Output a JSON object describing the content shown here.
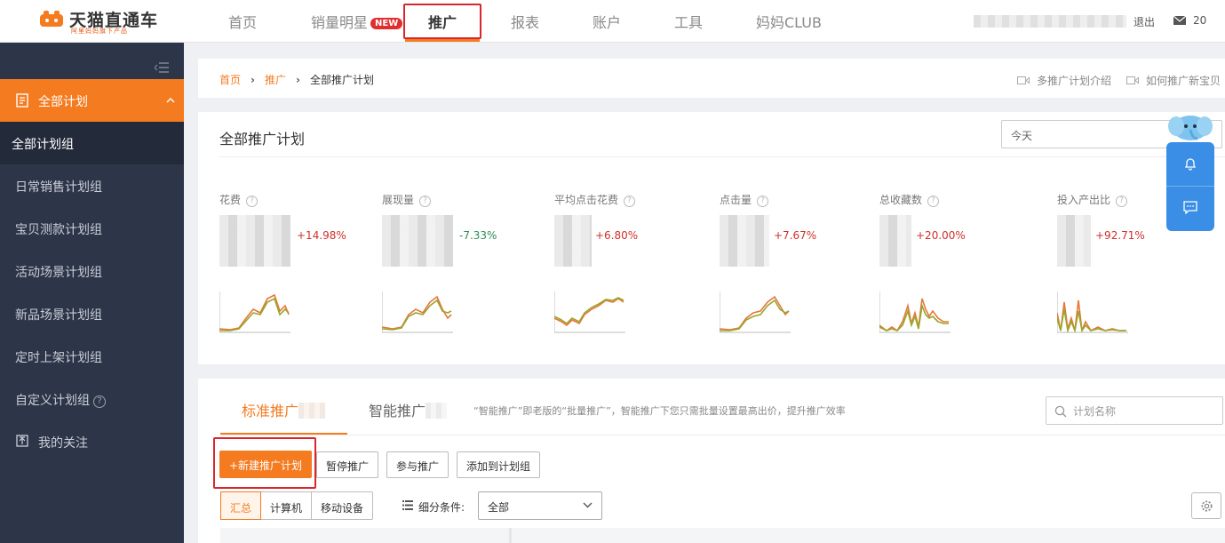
{
  "topnav": {
    "logo_title": "天猫直通车",
    "logo_sub": "阿里妈妈旗下产品",
    "items": [
      {
        "label": "首页"
      },
      {
        "label": "销量明星",
        "badge": "NEW"
      },
      {
        "label": "推广",
        "active": true
      },
      {
        "label": "报表"
      },
      {
        "label": "账户"
      },
      {
        "label": "工具"
      },
      {
        "label": "妈妈CLUB"
      }
    ],
    "logout": "退出",
    "mail_count": "20",
    "accent_color": "#f47b20"
  },
  "sidebar": {
    "header": "全部计划",
    "items": [
      {
        "label": "全部计划组",
        "active": true
      },
      {
        "label": "日常销售计划组"
      },
      {
        "label": "宝贝测款计划组"
      },
      {
        "label": "活动场景计划组"
      },
      {
        "label": "新品场景计划组"
      },
      {
        "label": "定时上架计划组"
      },
      {
        "label": "自定义计划组",
        "help": "?"
      },
      {
        "label": "我的关注"
      }
    ]
  },
  "breadcrumb": {
    "home": "首页",
    "mid": "推广",
    "current": "全部推广计划",
    "links": [
      "多推广计划介绍",
      "如何推广新宝贝"
    ]
  },
  "stats": {
    "title": "全部推广计划",
    "date_value": "今天",
    "metrics": [
      {
        "name": "花费",
        "change": "+14.98%",
        "trend": "up"
      },
      {
        "name": "展现量",
        "change": "-7.33%",
        "trend": "down"
      },
      {
        "name": "平均点击花费",
        "change": "+6.80%",
        "trend": "up"
      },
      {
        "name": "点击量",
        "change": "+7.67%",
        "trend": "up"
      },
      {
        "name": "总收藏数",
        "change": "+20.00%",
        "trend": "up"
      },
      {
        "name": "投入产出比",
        "change": "+92.71%",
        "trend": "up"
      }
    ],
    "up_color": "#d0302c",
    "down_color": "#2e8b57"
  },
  "plans": {
    "tabs": [
      {
        "label": "标准推广",
        "active": true
      },
      {
        "label": "智能推广"
      }
    ],
    "note": "“智能推广”即老版的“批量推广”，智能推广下您只需批量设置最高出价，提升推广效率",
    "search_placeholder": "计划名称",
    "buttons": {
      "new_plan": "+新建推广计划",
      "pause": "暂停推广",
      "join": "参与推广",
      "add_group": "添加到计划组"
    },
    "device_tabs": [
      "汇总",
      "计算机",
      "移动设备"
    ],
    "condition_label": "细分条件:",
    "condition_value": "全部"
  }
}
